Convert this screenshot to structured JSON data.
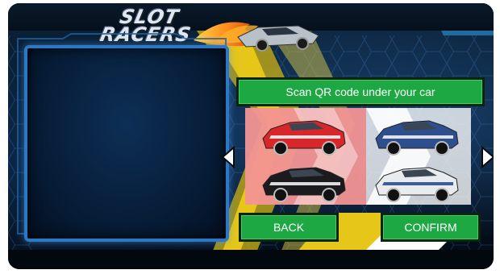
{
  "logo": {
    "line1": "SLOT",
    "line2": "RACERS"
  },
  "scan_banner": "Scan QR code under your car",
  "buttons": {
    "back": "BACK",
    "confirm": "CONFIRM"
  },
  "cars": [
    {
      "color_name": "red",
      "color": "#d8262a"
    },
    {
      "color_name": "blue",
      "color": "#2e4f8e"
    },
    {
      "color_name": "black",
      "color": "#1b1b1d"
    },
    {
      "color_name": "white",
      "color": "#e9ecef"
    }
  ],
  "colors": {
    "accent_green": "#1ea844",
    "panel_blue": "#2b78c4",
    "stripe_yellow": "#e6c619"
  }
}
